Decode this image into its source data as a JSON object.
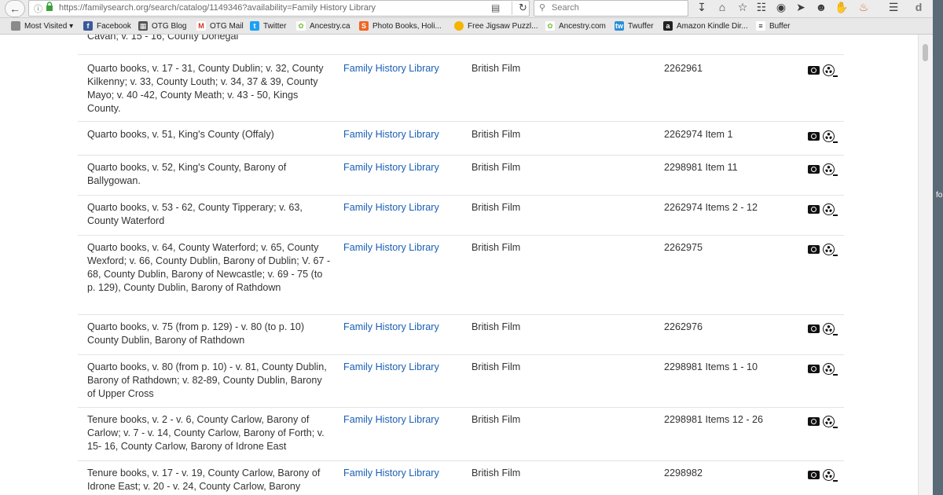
{
  "browser": {
    "url": "https://familysearch.org/search/catalog/1149346?availability=Family History Library",
    "search_placeholder": "Search",
    "side_text": "fo"
  },
  "bookmarks": [
    {
      "label": "Most Visited",
      "icon": "folder-icon"
    },
    {
      "label": "Facebook",
      "icon": "facebook-icon"
    },
    {
      "label": "OTG Blog",
      "icon": "blogger-icon"
    },
    {
      "label": "OTG Mail",
      "icon": "gmail-icon"
    },
    {
      "label": "Twitter",
      "icon": "twitter-icon"
    },
    {
      "label": "Ancestry.ca",
      "icon": "ancestry-icon"
    },
    {
      "label": "Photo Books, Holi...",
      "icon": "shutterfly-icon"
    },
    {
      "label": "Free Jigsaw Puzzl...",
      "icon": "puzzle-icon"
    },
    {
      "label": "Ancestry.com",
      "icon": "ancestry-icon"
    },
    {
      "label": "Twuffer",
      "icon": "twuffer-icon"
    },
    {
      "label": "Amazon Kindle Dir...",
      "icon": "amazon-icon"
    },
    {
      "label": "Buffer",
      "icon": "buffer-icon"
    }
  ],
  "table": {
    "rows": [
      {
        "title": "Cavan; v. 15 - 16, County Donegal",
        "repository": "",
        "format": "",
        "film": ""
      },
      {
        "title": "Quarto books, v. 17 - 31, County Dublin; v. 32, County Kilkenny; v. 33, County Louth; v. 34, 37 & 39, County Mayo; v. 40 -42, County Meath; v. 43 - 50, Kings County.",
        "repository": "Family History Library",
        "format": "British Film",
        "film": "2262961"
      },
      {
        "title": "Quarto books, v. 51, King's County (Offaly)",
        "repository": "Family History Library",
        "format": "British Film",
        "film": "2262974 Item 1"
      },
      {
        "title": "Quarto books, v. 52, King's County, Barony of Ballygowan.",
        "repository": "Family History Library",
        "format": "British Film",
        "film": "2298981 Item 11"
      },
      {
        "title": "Quarto books, v. 53 - 62, County Tipperary; v. 63, County Waterford",
        "repository": "Family History Library",
        "format": "British Film",
        "film": "2262974 Items 2 - 12"
      },
      {
        "title": "Quarto books, v. 64, County Waterford; v. 65, County Wexford; v. 66, County Dublin, Barony of Dublin; V. 67 - 68, County Dublin, Barony of Newcastle; v. 69 - 75 (to p. 129), County Dublin, Barony of Rathdown",
        "repository": "Family History Library",
        "format": "British Film",
        "film": "2262975"
      },
      {
        "title": "Quarto books, v. 75 (from p. 129) - v. 80 (to p. 10) County Dublin, Barony of Rathdown",
        "repository": "Family History Library",
        "format": "British Film",
        "film": "2262976"
      },
      {
        "title": "Quarto books, v. 80 (from p. 10) - v. 81, County Dublin, Barony of Rathdown; v. 82-89, County Dublin, Barony of Upper Cross",
        "repository": "Family History Library",
        "format": "British Film",
        "film": "2298981 Items 1 - 10"
      },
      {
        "title": "Tenure books, v. 2 - v. 6, County Carlow, Barony of Carlow; v. 7 - v. 14, County Carlow, Barony of Forth; v. 15- 16, County Carlow, Barony of Idrone East",
        "repository": "Family History Library",
        "format": "British Film",
        "film": "2298981 Items 12 - 26"
      },
      {
        "title": "Tenure books, v. 17 - v. 19, County Carlow, Barony of Idrone East; v. 20 - v. 24, County Carlow, Barony",
        "repository": "Family History Library",
        "format": "British Film",
        "film": "2298982"
      }
    ]
  }
}
